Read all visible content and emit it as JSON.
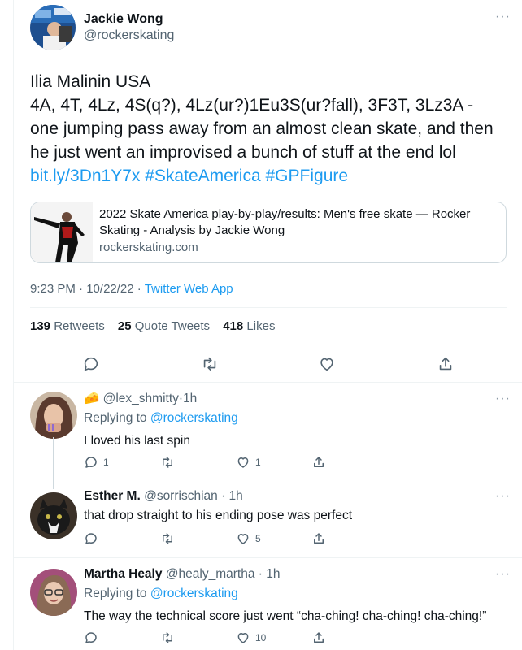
{
  "main_tweet": {
    "author_name": "Jackie Wong",
    "author_handle": "@rockerskating",
    "more_label": "···",
    "text_lines": [
      "Ilia Malinin USA",
      "4A, 4T, 4Lz, 4S(q?), 4Lz(ur?)1Eu3S(ur?fall), 3F3T, 3Lz3A -",
      "one jumping pass away from an almost clean skate, and then",
      "he just went an improvised a bunch of stuff at the end lol"
    ],
    "link": "bit.ly/3Dn1Y7x",
    "hashtags": [
      "#SkateAmerica",
      "#GPFigure"
    ],
    "card": {
      "title": "2022 Skate America play-by-play/results: Men's free skate — Rocker Skating - Analysis by Jackie Wong",
      "domain": "rockerskating.com"
    },
    "time": "9:23 PM",
    "date": "10/22/22",
    "separator": "·",
    "source": "Twitter Web App",
    "stats": {
      "retweets_count": "139",
      "retweets_label": "Retweets",
      "quotes_count": "25",
      "quotes_label": "Quote Tweets",
      "likes_count": "418",
      "likes_label": "Likes"
    },
    "action_icons": [
      "reply-icon",
      "retweet-icon",
      "like-icon",
      "share-icon"
    ]
  },
  "replies": [
    {
      "emoji": "🧀",
      "name": "",
      "handle": "@lex_shmitty",
      "time": "1h",
      "replying_to_label": "Replying to",
      "replying_to": "@rockerskating",
      "text": "I loved his last spin",
      "reply_count": "1",
      "retweet_count": "",
      "like_count": "1"
    },
    {
      "name": "Esther M.",
      "handle": "@sorrischian",
      "time": "1h",
      "text": "that drop straight to his ending pose was perfect",
      "reply_count": "",
      "retweet_count": "",
      "like_count": "5"
    },
    {
      "name": "Martha Healy",
      "handle": "@healy_martha",
      "time": "1h",
      "replying_to_label": "Replying to",
      "replying_to": "@rockerskating",
      "text": "The way the technical score just went “cha-ching! cha-ching! cha-ching!”",
      "reply_count": "",
      "retweet_count": "",
      "like_count": "10"
    }
  ],
  "colors": {
    "accent": "#1d9bf0",
    "text": "#0f1419",
    "secondary": "#536471",
    "divider": "#eff3f4"
  }
}
